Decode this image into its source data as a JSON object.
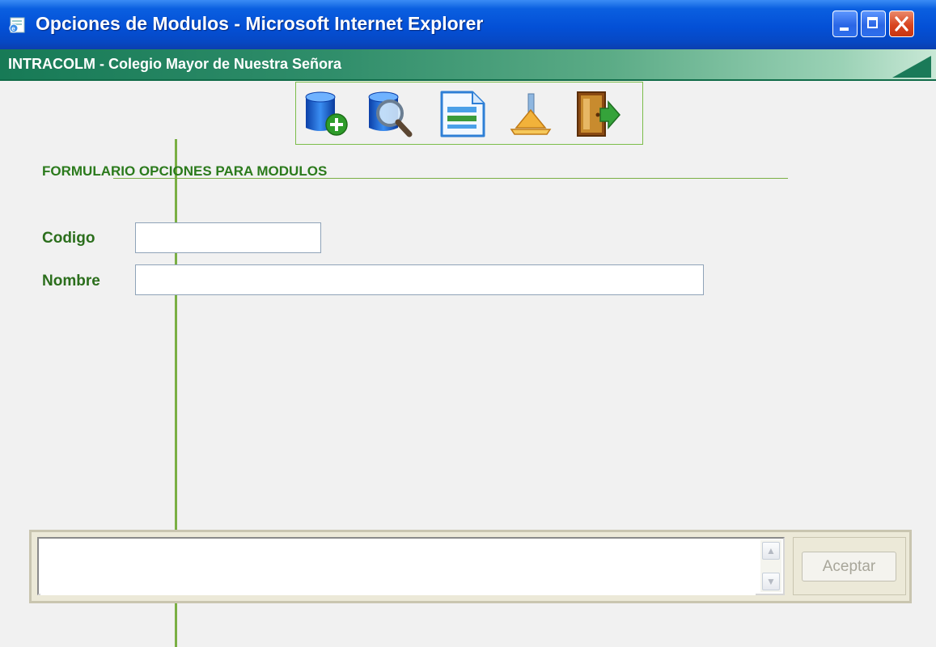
{
  "window": {
    "title": "Opciones de Modulos - Microsoft Internet Explorer",
    "icon": "ie-page-icon",
    "controls": [
      "minimize-icon",
      "maximize-icon",
      "close-icon"
    ]
  },
  "app_header": {
    "title": "INTRACOLM - Colegio Mayor de Nuestra Señora"
  },
  "toolbar": {
    "buttons": [
      {
        "name": "database-add-icon"
      },
      {
        "name": "database-search-icon"
      },
      {
        "name": "document-icon"
      },
      {
        "name": "broom-icon"
      },
      {
        "name": "exit-door-icon"
      }
    ]
  },
  "form": {
    "title": "FORMULARIO OPCIONES PARA MODULOS",
    "fields": {
      "codigo": {
        "label": "Codigo",
        "value": ""
      },
      "nombre": {
        "label": "Nombre",
        "value": ""
      }
    }
  },
  "message_panel": {
    "text": "",
    "accept_label": "Aceptar"
  },
  "colors": {
    "titlebar_blue": "#0450d6",
    "header_green": "#177a56",
    "accent_green": "#7aaf44",
    "label_green": "#2b6e1c",
    "panel_beige": "#ece9d8"
  }
}
